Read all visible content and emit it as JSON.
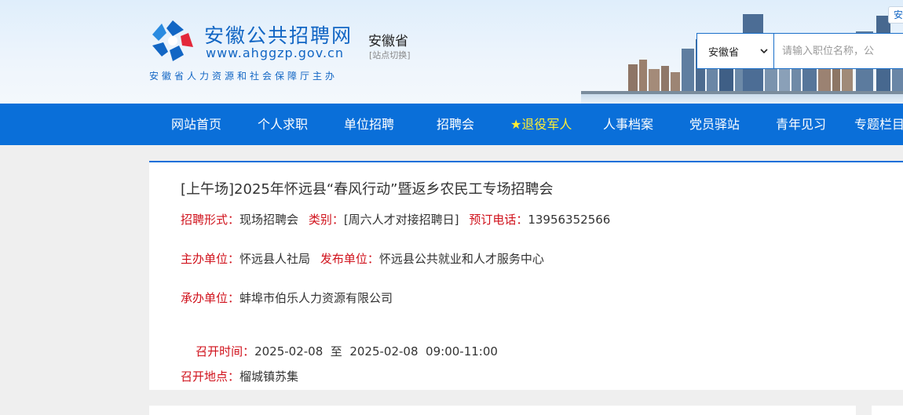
{
  "header": {
    "site_title": "安徽公共招聘网",
    "site_url": "www.ahggzp.gov.cn",
    "site_sub": "安徽省人力资源和社会保障厅主办",
    "province": "安徽省",
    "switch_label": "[站点切换]",
    "corner_badge": "安"
  },
  "search": {
    "province_select": "安徽省",
    "placeholder": "请输入职位名称，公"
  },
  "nav": {
    "items": [
      {
        "label": "网站首页"
      },
      {
        "label": "个人求职"
      },
      {
        "label": "单位招聘"
      },
      {
        "label": "招聘会"
      },
      {
        "label": "★退役军人"
      },
      {
        "label": "人事档案"
      },
      {
        "label": "党员驿站"
      },
      {
        "label": "青年见习"
      },
      {
        "label": "专题栏目"
      }
    ]
  },
  "fair": {
    "title": "[上午场]2025年怀远县“春风行动”暨返乡农民工专场招聘会",
    "form_label": "招聘形式：",
    "form_value": "现场招聘会",
    "category_label": "类别：",
    "category_value": "[周六人才对接招聘日]",
    "phone_label": "预订电话：",
    "phone_value": "13956352566",
    "host_label": "主办单位：",
    "host_value": "怀远县人社局",
    "publisher_label": "发布单位：",
    "publisher_value": "怀远县公共就业和人才服务中心",
    "organizer_label": "承办单位：",
    "organizer_value": "蚌埠市伯乐人力资源有限公司",
    "time_label": "召开时间：",
    "time_value": "2025-02-08  至  2025-02-08  09:00-11:00",
    "place_label": "召开地点：",
    "place_value": "榴城镇苏集"
  },
  "colors": {
    "brand_blue": "#0a6fd9",
    "label_red": "#d0111b",
    "star_yellow": "#ffee33"
  }
}
